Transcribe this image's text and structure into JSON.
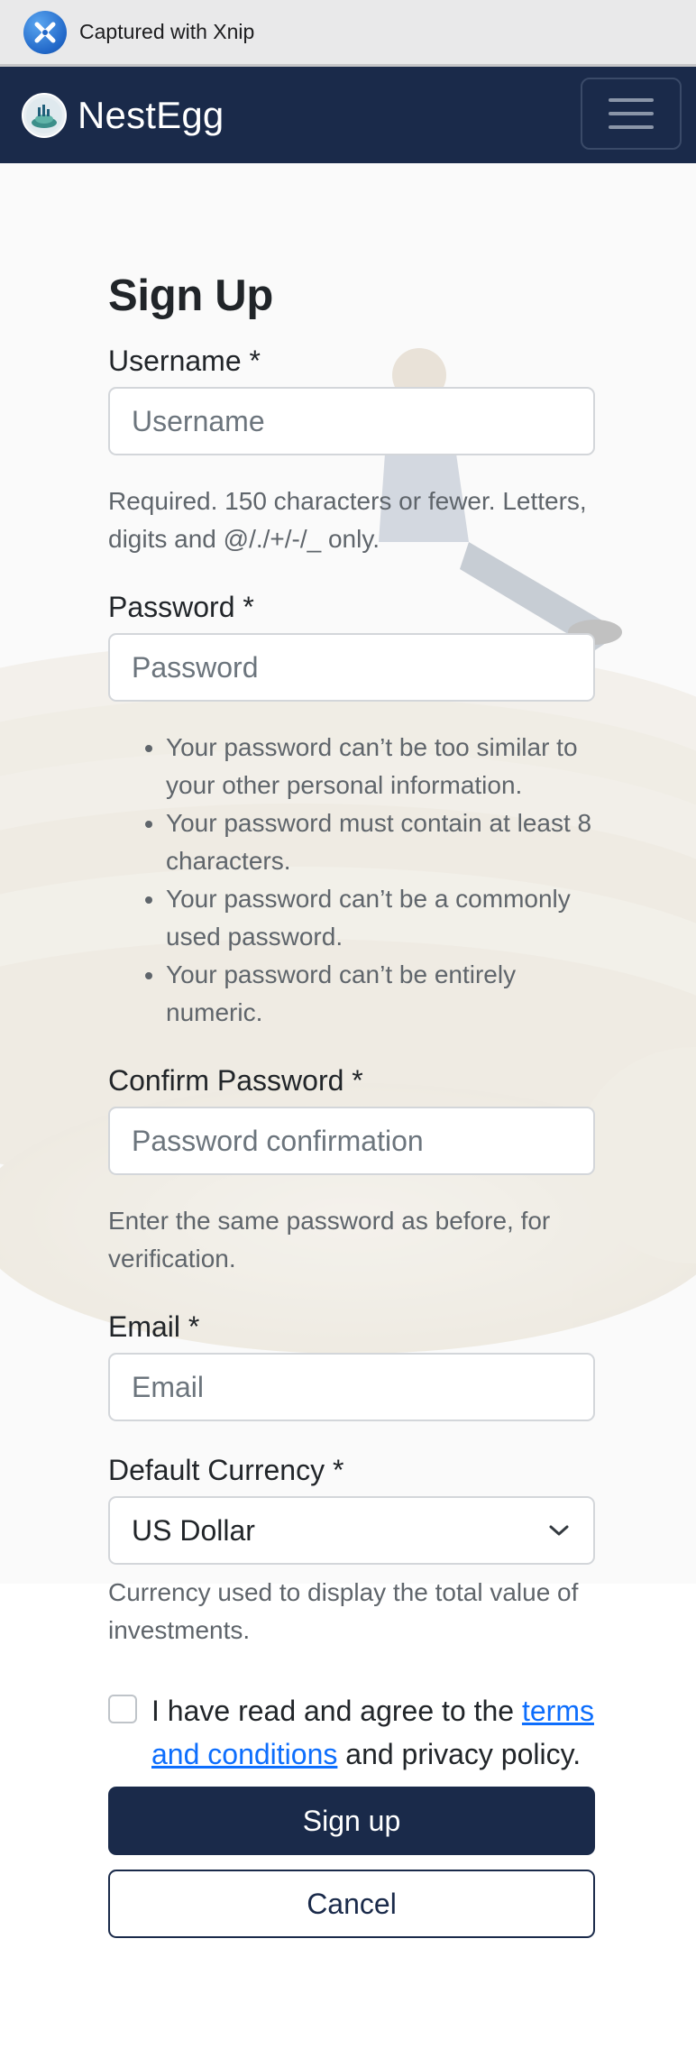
{
  "capture": {
    "text": "Captured with Xnip",
    "icon": "xnip-logo-icon"
  },
  "navbar": {
    "brand": "NestEgg",
    "logo_icon": "nestegg-logo-icon",
    "toggler_icon": "hamburger-menu-icon",
    "color": "#1a2a4a"
  },
  "form": {
    "title": "Sign Up",
    "username": {
      "label": "Username *",
      "placeholder": "Username",
      "value": "",
      "help": "Required. 150 characters or fewer. Letters, digits and @/./+/-/_ only."
    },
    "password": {
      "label": "Password *",
      "placeholder": "Password",
      "value": "",
      "rules": [
        "Your password can’t be too similar to your other personal information.",
        "Your password must contain at least 8 characters.",
        "Your password can’t be a commonly used password.",
        "Your password can’t be entirely numeric."
      ]
    },
    "confirm": {
      "label": "Confirm Password *",
      "placeholder": "Password confirmation",
      "value": "",
      "help": "Enter the same password as before, for verification."
    },
    "email": {
      "label": "Email *",
      "placeholder": "Email",
      "value": ""
    },
    "currency": {
      "label": "Default Currency *",
      "selected": "US Dollar",
      "help": "Currency used to display the total value of investments.",
      "icon": "chevron-down-icon"
    },
    "terms": {
      "prefix": "I have read and agree to the ",
      "link": "terms and conditions",
      "suffix": " and privacy policy.",
      "checked": false
    },
    "submit_label": "Sign up",
    "cancel_label": "Cancel"
  }
}
